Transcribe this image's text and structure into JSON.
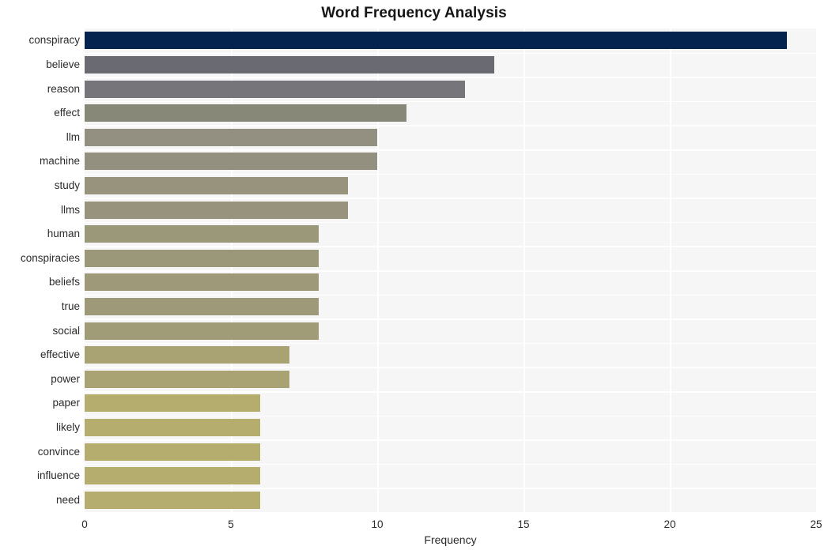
{
  "chart_data": {
    "type": "bar",
    "orientation": "horizontal",
    "title": "Word Frequency Analysis",
    "xlabel": "Frequency",
    "ylabel": "",
    "xlim": [
      0,
      25
    ],
    "xticks": [
      0,
      5,
      10,
      15,
      20,
      25
    ],
    "xtick_labels": [
      "0",
      "5",
      "10",
      "15",
      "20",
      "25"
    ],
    "grid": true,
    "legend": false,
    "categories": [
      "conspiracy",
      "believe",
      "reason",
      "effect",
      "llm",
      "machine",
      "study",
      "llms",
      "human",
      "conspiracies",
      "beliefs",
      "true",
      "social",
      "effective",
      "power",
      "paper",
      "likely",
      "convince",
      "influence",
      "need"
    ],
    "values": [
      24,
      14,
      13,
      11,
      10,
      10,
      9,
      9,
      8,
      8,
      8,
      8,
      8,
      7,
      7,
      6,
      6,
      6,
      6,
      6
    ],
    "bar_colors": [
      "#04234f",
      "#6a6a72",
      "#75757a",
      "#888879",
      "#939082",
      "#93907f",
      "#97937c",
      "#97937c",
      "#9b9779",
      "#9b9779",
      "#9e9a79",
      "#9e9a79",
      "#a09c78",
      "#a9a373",
      "#a9a373",
      "#b5ad6e",
      "#b5ad6e",
      "#b5ad6e",
      "#b5ad6e",
      "#b5ad6e"
    ],
    "plot_bgcolor": "#f6f6f6",
    "grid_color": "#ffffff",
    "figure_bgcolor": "#ffffff",
    "title_color": "#161616",
    "tick_color": "#2b2b2b"
  }
}
